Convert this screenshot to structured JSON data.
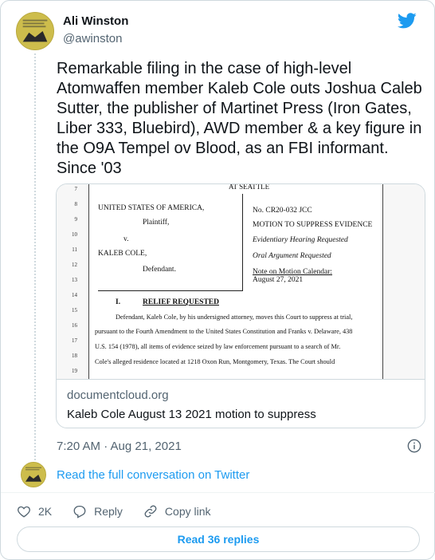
{
  "author": {
    "name": "Ali Winston",
    "handle": "@awinston"
  },
  "tweet": {
    "text": "Remarkable filing in the case of high-level Atomwaffen member Kaleb Cole outs Joshua Caleb Sutter, the publisher of Martinet Press (Iron Gates, Liber 333, Bluebird), AWD member & a key figure in the O9A Tempel ov Blood, as an FBI informant. Since '03",
    "timestamp": "7:20 AM · Aug 21, 2021"
  },
  "link_card": {
    "domain": "documentcloud.org",
    "title": "Kaleb Cole August 13 2021 motion to suppress",
    "document": {
      "court_header": "AT SEATTLE",
      "line_numbers": [
        "7",
        "8",
        "9",
        "10",
        "11",
        "12",
        "13",
        "14",
        "15",
        "16",
        "17",
        "18",
        "19"
      ],
      "plaintiff_party": "UNITED STATES OF AMERICA,",
      "plaintiff_role": "Plaintiff,",
      "versus": "v.",
      "defendant_party": "KALEB COLE,",
      "defendant_role": "Defendant.",
      "case_no": "No. CR20-032 JCC",
      "motion_title": "MOTION TO SUPPRESS EVIDENCE",
      "hearing": "Evidentiary Hearing Requested",
      "oral_argument": "Oral Argument Requested",
      "calendar_note": "Note on Motion Calendar:",
      "calendar_date": "August 27, 2021",
      "section_number": "I.",
      "section_title": "RELIEF REQUESTED",
      "body_lines": [
        "Defendant, Kaleb Cole, by his undersigned attorney, moves this Court to suppress at trial,",
        "pursuant to the Fourth Amendment to the United States Constitution and Franks v. Delaware, 438",
        "U.S. 154 (1978), all items of evidence seized by law enforcement pursuant to a search of Mr.",
        "Cole's alleged residence located at 1218 Oxon Run, Montgomery, Texas.  The Court should"
      ]
    }
  },
  "read_conversation": "Read the full conversation on Twitter",
  "actions": {
    "likes": "2K",
    "reply": "Reply",
    "copy_link": "Copy link"
  },
  "read_replies": "Read 36 replies",
  "colors": {
    "accent": "#1d9bf0",
    "muted": "#536471",
    "text": "#0f1419",
    "border": "#cfd9de"
  }
}
